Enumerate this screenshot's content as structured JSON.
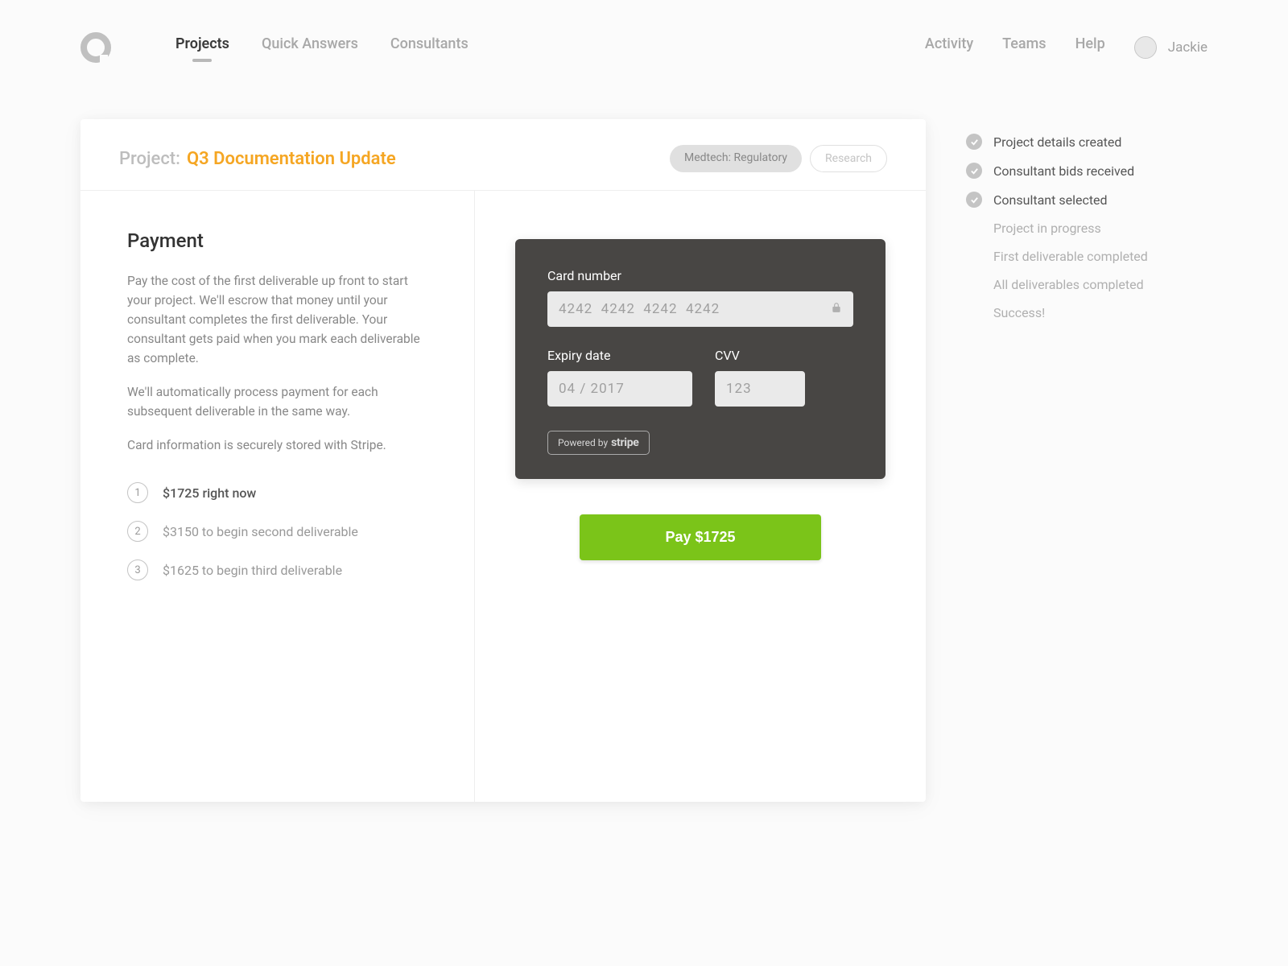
{
  "nav": {
    "left": [
      "Projects",
      "Quick Answers",
      "Consultants"
    ],
    "right": [
      "Activity",
      "Teams",
      "Help"
    ],
    "active": "Projects",
    "username": "Jackie"
  },
  "project": {
    "label": "Project:",
    "name": "Q3 Documentation Update",
    "tags": [
      {
        "text": "Medtech: Regulatory",
        "style": "filled"
      },
      {
        "text": "Research",
        "style": "outline"
      }
    ]
  },
  "payment": {
    "heading": "Payment",
    "paragraphs": [
      "Pay the cost of the first deliverable up front to start your project. We'll escrow that money until your consultant completes the first deliverable. Your consultant gets paid when you mark each deliverable as complete.",
      "We'll automatically process payment for each subsequent deliverable in the same way.",
      "Card information is securely stored with Stripe."
    ],
    "items": [
      {
        "n": "1",
        "text": "$1725 right now",
        "first": true
      },
      {
        "n": "2",
        "text": "$3150 to begin second deliverable"
      },
      {
        "n": "3",
        "text": "$1625 to begin third deliverable"
      }
    ]
  },
  "cardForm": {
    "numberLabel": "Card number",
    "numberPlaceholder": "4242  4242  4242  4242",
    "expiryLabel": "Expiry date",
    "expiryPlaceholder": "04 / 2017",
    "cvvLabel": "CVV",
    "cvvPlaceholder": "123",
    "poweredByPrefix": "Powered by",
    "poweredByBrand": "stripe"
  },
  "payButton": "Pay $1725",
  "steps": [
    {
      "label": "Project details created",
      "done": true
    },
    {
      "label": "Consultant bids received",
      "done": true
    },
    {
      "label": "Consultant selected",
      "done": true
    },
    {
      "label": "Project in progress",
      "done": false
    },
    {
      "label": "First deliverable completed",
      "done": false
    },
    {
      "label": "All deliverables completed",
      "done": false
    },
    {
      "label": "Success!",
      "done": false
    }
  ]
}
